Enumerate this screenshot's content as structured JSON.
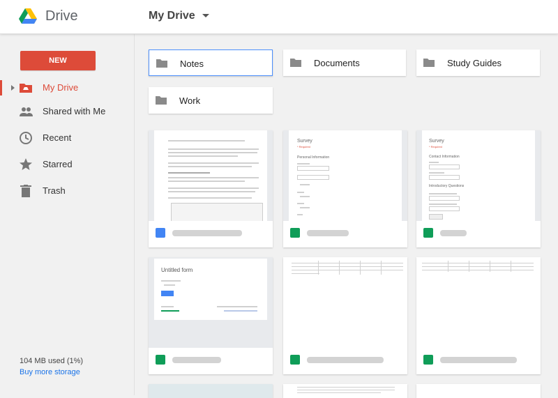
{
  "header": {
    "app_name": "Drive",
    "breadcrumb": "My Drive"
  },
  "sidebar": {
    "new_label": "NEW",
    "items": [
      {
        "label": "My Drive",
        "icon": "drive-icon",
        "active": true
      },
      {
        "label": "Shared with Me",
        "icon": "people-icon"
      },
      {
        "label": "Recent",
        "icon": "clock-icon"
      },
      {
        "label": "Starred",
        "icon": "star-icon"
      },
      {
        "label": "Trash",
        "icon": "trash-icon"
      }
    ],
    "storage_used": "104 MB used (1%)",
    "buy_storage": "Buy more storage"
  },
  "folders": [
    {
      "name": "Notes",
      "selected": true
    },
    {
      "name": "Documents"
    },
    {
      "name": "Study Guides"
    },
    {
      "name": "Work"
    }
  ],
  "files": [
    {
      "type": "doc",
      "thumb": "document"
    },
    {
      "type": "form",
      "thumb": "Survey"
    },
    {
      "type": "form",
      "thumb": "Survey"
    },
    {
      "type": "form",
      "thumb": "Untitled form"
    },
    {
      "type": "sheet",
      "thumb": "spreadsheet"
    },
    {
      "type": "sheet",
      "thumb": "spreadsheet"
    }
  ],
  "thumbnails": {
    "survey_title": "Survey",
    "survey_required": "* Required",
    "survey1_section": "Personal Information",
    "survey2_section": "Contact Information",
    "survey2_section2": "Introductory Questions",
    "untitled_form_title": "Untitled form"
  },
  "colors": {
    "accent": "#dd4b39",
    "doc": "#4285f4",
    "form": "#0f9d58",
    "sheet": "#0f9d58",
    "link": "#1a73e8"
  }
}
